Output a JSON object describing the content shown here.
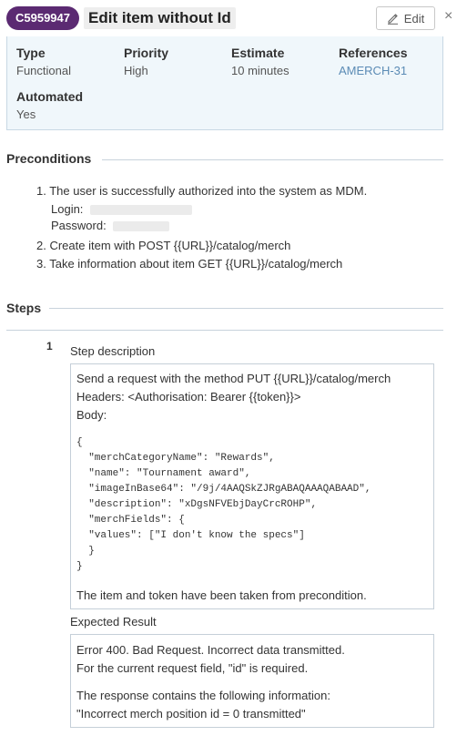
{
  "header": {
    "case_id": "C5959947",
    "title": "Edit item without Id",
    "edit_label": "Edit",
    "close_glyph": "×"
  },
  "info": {
    "type_label": "Type",
    "type_value": "Functional",
    "priority_label": "Priority",
    "priority_value": "High",
    "estimate_label": "Estimate",
    "estimate_value": "10 minutes",
    "references_label": "References",
    "references_value": "AMERCH-31",
    "automated_label": "Automated",
    "automated_value": "Yes"
  },
  "preconditions": {
    "title": "Preconditions",
    "items": [
      "1. The user is successfully authorized into the system as MDM.",
      "2. Create item with POST {{URL}}/catalog/merch",
      "3. Take information about item GET {{URL}}/catalog/merch"
    ],
    "login_label": "Login:",
    "password_label": "Password:"
  },
  "steps": {
    "title": "Steps",
    "step_number": "1",
    "description_label": "Step description",
    "description_lines": [
      "Send a request with the method PUT {{URL}}/catalog/merch",
      "Headers: <Authorisation: Bearer {{token}}>",
      "Body:"
    ],
    "code_lines": [
      "{",
      "  \"merchCategoryName\": \"Rewards\",",
      "  \"name\": \"Tournament award\",",
      "  \"imageInBase64\": \"/9j/4AAQSkZJRgABAQAAAQABAAD\",",
      "  \"description\": \"xDgsNFVEbjDayCrcROHP\",",
      "  \"merchFields\": {",
      "  \"values\": [\"I don't know the specs\"]",
      "  }",
      "}"
    ],
    "description_footer": "The item and token have been taken from precondition.",
    "expected_label": "Expected Result",
    "expected_lines": [
      "Error 400. Bad Request. Incorrect data transmitted.",
      "For the current request field, \"id\" is required.",
      "The response contains the following information:",
      "\"Incorrect merch position id = 0 transmitted\""
    ]
  },
  "icons": {
    "edit": "pencil-icon",
    "close": "close-icon"
  }
}
